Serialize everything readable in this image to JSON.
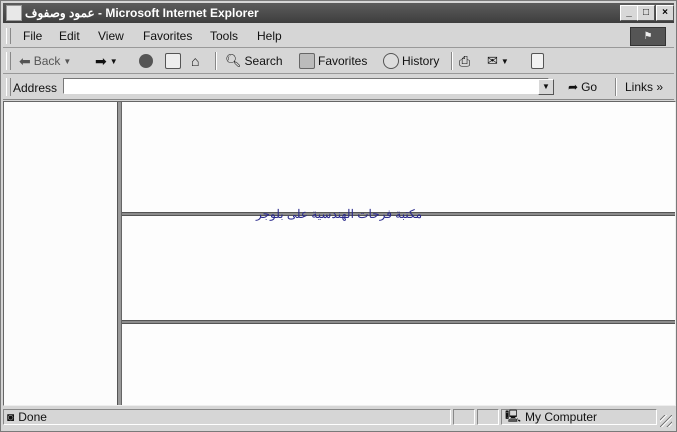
{
  "window": {
    "title_arabic": "عمود وصفوف",
    "title_app": " - Microsoft Internet Explorer",
    "buttons": [
      "_",
      "□",
      "×"
    ]
  },
  "menubar": {
    "items": [
      {
        "label": "File"
      },
      {
        "label": "Edit"
      },
      {
        "label": "View"
      },
      {
        "label": "Favorites"
      },
      {
        "label": "Tools"
      },
      {
        "label": "Help"
      }
    ]
  },
  "toolbar": {
    "back_label": "Back",
    "search_label": "Search",
    "favorites_label": "Favorites",
    "history_label": "History"
  },
  "address": {
    "label": "Address",
    "value": "",
    "go_label": "Go",
    "links_label": "Links",
    "links_chevron": "»"
  },
  "content": {
    "watermark": "مكتبة فرحات الهندسية على بلوجر"
  },
  "status": {
    "text": "Done",
    "zone": "My Computer"
  }
}
